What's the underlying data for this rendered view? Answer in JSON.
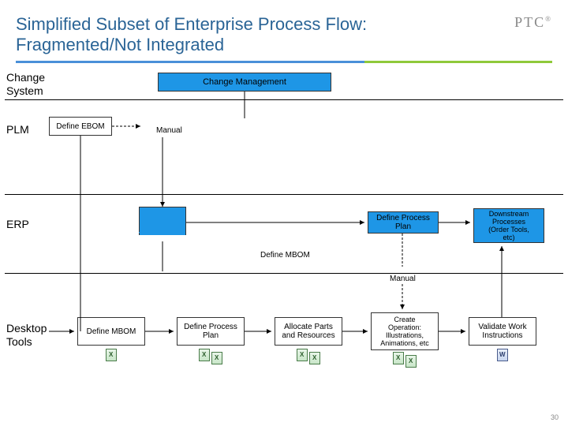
{
  "header": {
    "title_line1": "Simplified Subset of Enterprise Process Flow:",
    "title_line2": "Fragmented/Not Integrated",
    "logo_text": "PTC",
    "logo_reg": "®"
  },
  "rows": {
    "change_system": "Change\nSystem",
    "plm": "PLM",
    "erp": "ERP",
    "desktop_tools": "Desktop\nTools"
  },
  "boxes": {
    "change_management": "Change Management",
    "define_ebom": "Define EBOM",
    "define_process_plan_erp": "Define Process\nPlan",
    "downstream": "Downstream\nProcesses\n(Order Tools,\netc)",
    "define_mbom_label": "Define MBOM",
    "define_mbom_desktop": "Define MBOM",
    "define_process_plan_desktop": "Define Process\nPlan",
    "allocate_parts": "Allocate Parts\nand Resources",
    "create_operation": "Create\nOperation:\nIllustrations,\nAnimations, etc",
    "validate_work": "Validate Work\nInstructions"
  },
  "labels": {
    "manual1": "Manual",
    "manual2": "Manual"
  },
  "page_number": "30"
}
